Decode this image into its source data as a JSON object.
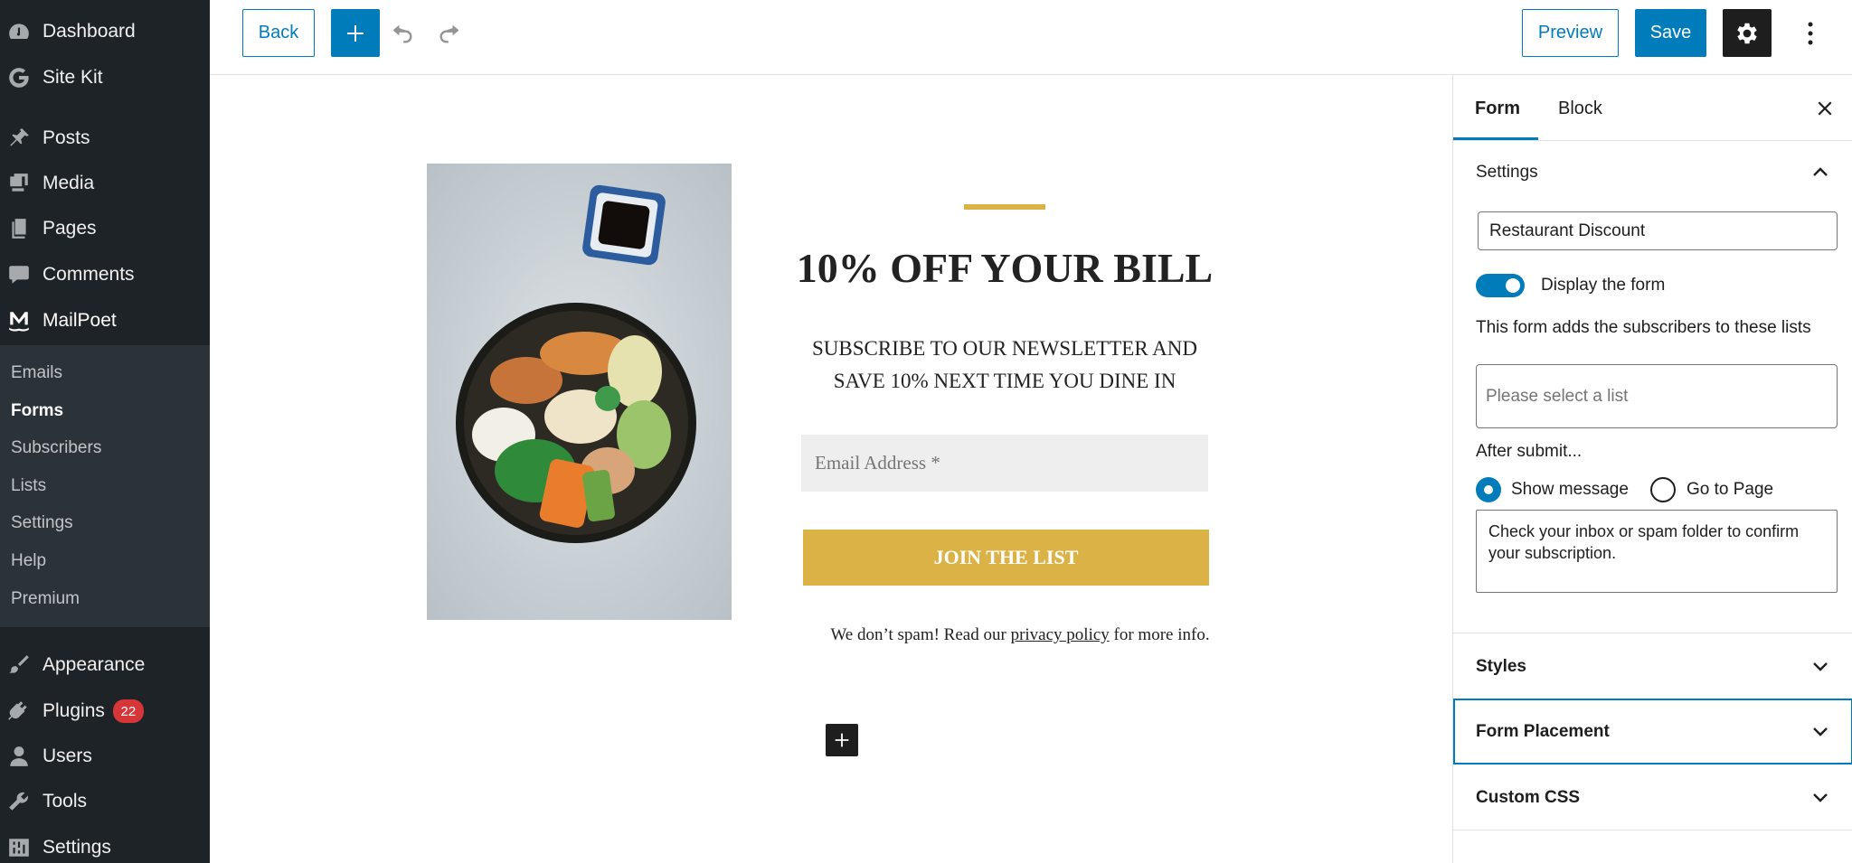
{
  "admin_menu": {
    "items": [
      {
        "label": "Dashboard",
        "icon": "dashboard-icon"
      },
      {
        "label": "Site Kit",
        "icon": "google-g-icon"
      },
      {
        "label": "Posts",
        "icon": "pin-icon"
      },
      {
        "label": "Media",
        "icon": "media-icon"
      },
      {
        "label": "Pages",
        "icon": "pages-icon"
      },
      {
        "label": "Comments",
        "icon": "comment-icon"
      },
      {
        "label": "MailPoet",
        "icon": "mailpoet-icon"
      }
    ],
    "submenu": [
      "Emails",
      "Forms",
      "Subscribers",
      "Lists",
      "Settings",
      "Help",
      "Premium"
    ],
    "active_submenu": "Forms",
    "bottom_items": [
      {
        "label": "Appearance",
        "icon": "brush-icon"
      },
      {
        "label": "Plugins",
        "icon": "plugin-icon",
        "badge": "22"
      },
      {
        "label": "Users",
        "icon": "user-icon"
      },
      {
        "label": "Tools",
        "icon": "wrench-icon"
      },
      {
        "label": "Settings",
        "icon": "settings-sliders-icon"
      }
    ]
  },
  "toolbar": {
    "back_label": "Back",
    "preview_label": "Preview",
    "save_label": "Save"
  },
  "form_preview": {
    "headline": "10% OFF YOUR BILL",
    "subhead_line1": "SUBSCRIBE TO OUR NEWSLETTER AND",
    "subhead_line2": "SAVE 10% NEXT TIME YOU DINE IN",
    "email_placeholder": "Email Address *",
    "button_label": "JOIN THE LIST",
    "spam_before": "We don’t spam! Read our ",
    "spam_link": "privacy policy",
    "spam_after": " for more info.",
    "accent_color": "#dbb245"
  },
  "panel": {
    "tabs": [
      "Form",
      "Block"
    ],
    "active_tab": "Form",
    "settings_title": "Settings",
    "form_name": "Restaurant Discount",
    "display_form_label": "Display the form",
    "display_form_on": true,
    "lists_label": "This form adds the subscribers to these lists",
    "lists_placeholder": "Please select a list",
    "after_submit_label": "After submit...",
    "show_message_label": "Show message",
    "go_to_page_label": "Go to Page",
    "selected_after_submit": "Show message",
    "message_text": "Check your inbox or spam folder to confirm your subscription.",
    "sections": [
      "Styles",
      "Form Placement",
      "Custom CSS"
    ]
  },
  "colors": {
    "primary": "#007cba",
    "admin_bg": "#1d2327",
    "badge": "#d63638"
  }
}
